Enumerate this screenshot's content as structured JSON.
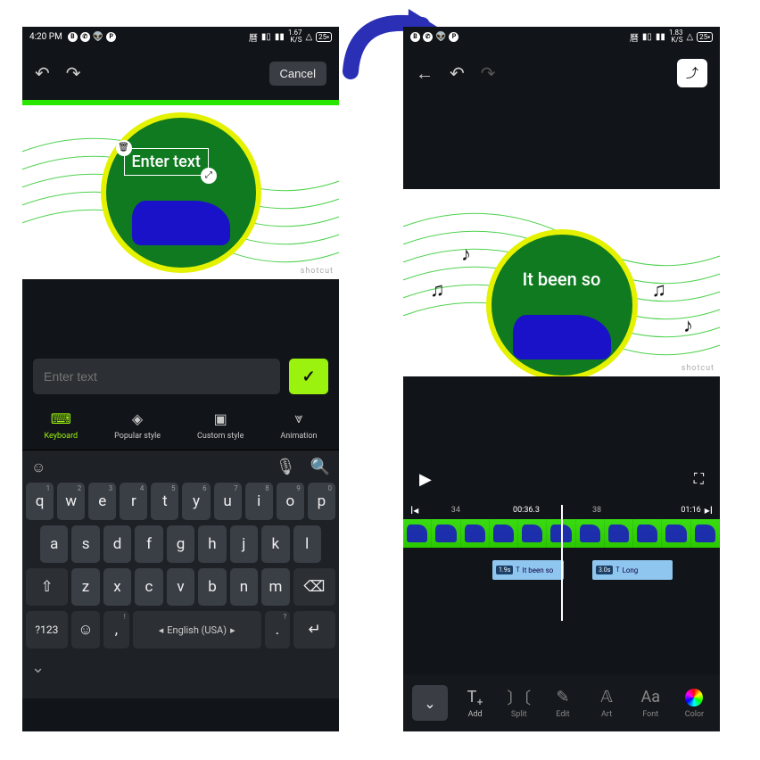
{
  "status": {
    "time": "4:20 PM",
    "net_left": "1.67",
    "net_unit": "K/S",
    "thermal": "△",
    "battery_left": "25",
    "net_right": "1.83",
    "battery_right": "25"
  },
  "left": {
    "cancel": "Cancel",
    "overlay_text": "Enter text",
    "input_placeholder": "Enter text",
    "tabs": {
      "keyboard": "Keyboard",
      "popular": "Popular style",
      "custom": "Custom style",
      "animation": "Animation"
    },
    "keyboard": {
      "row1": [
        "q",
        "w",
        "e",
        "r",
        "t",
        "y",
        "u",
        "i",
        "o",
        "p"
      ],
      "row1_sup": [
        "1",
        "2",
        "3",
        "4",
        "5",
        "6",
        "7",
        "8",
        "9",
        "0"
      ],
      "row2": [
        "a",
        "s",
        "d",
        "f",
        "g",
        "h",
        "j",
        "k",
        "l"
      ],
      "row3": [
        "z",
        "x",
        "c",
        "v",
        "b",
        "n",
        "m"
      ],
      "num": "?123",
      "lang": "English (USA)",
      "comma": ",",
      "period": ".",
      "excl": "!",
      "quest": "?"
    }
  },
  "right": {
    "overlay_text": "It been so",
    "watermark": "shotcut",
    "ruler": {
      "t1": "34",
      "t2": "00:36.3",
      "t3": "38",
      "end": "01:16"
    },
    "clips": {
      "c1_dur": "1.9s",
      "c1_label": "It been so",
      "c2_dur": "3.0s",
      "c2_label": "Long"
    },
    "bottom": {
      "add": "Add",
      "split": "Split",
      "edit": "Edit",
      "art": "Art",
      "font": "Font",
      "color": "Color"
    }
  }
}
